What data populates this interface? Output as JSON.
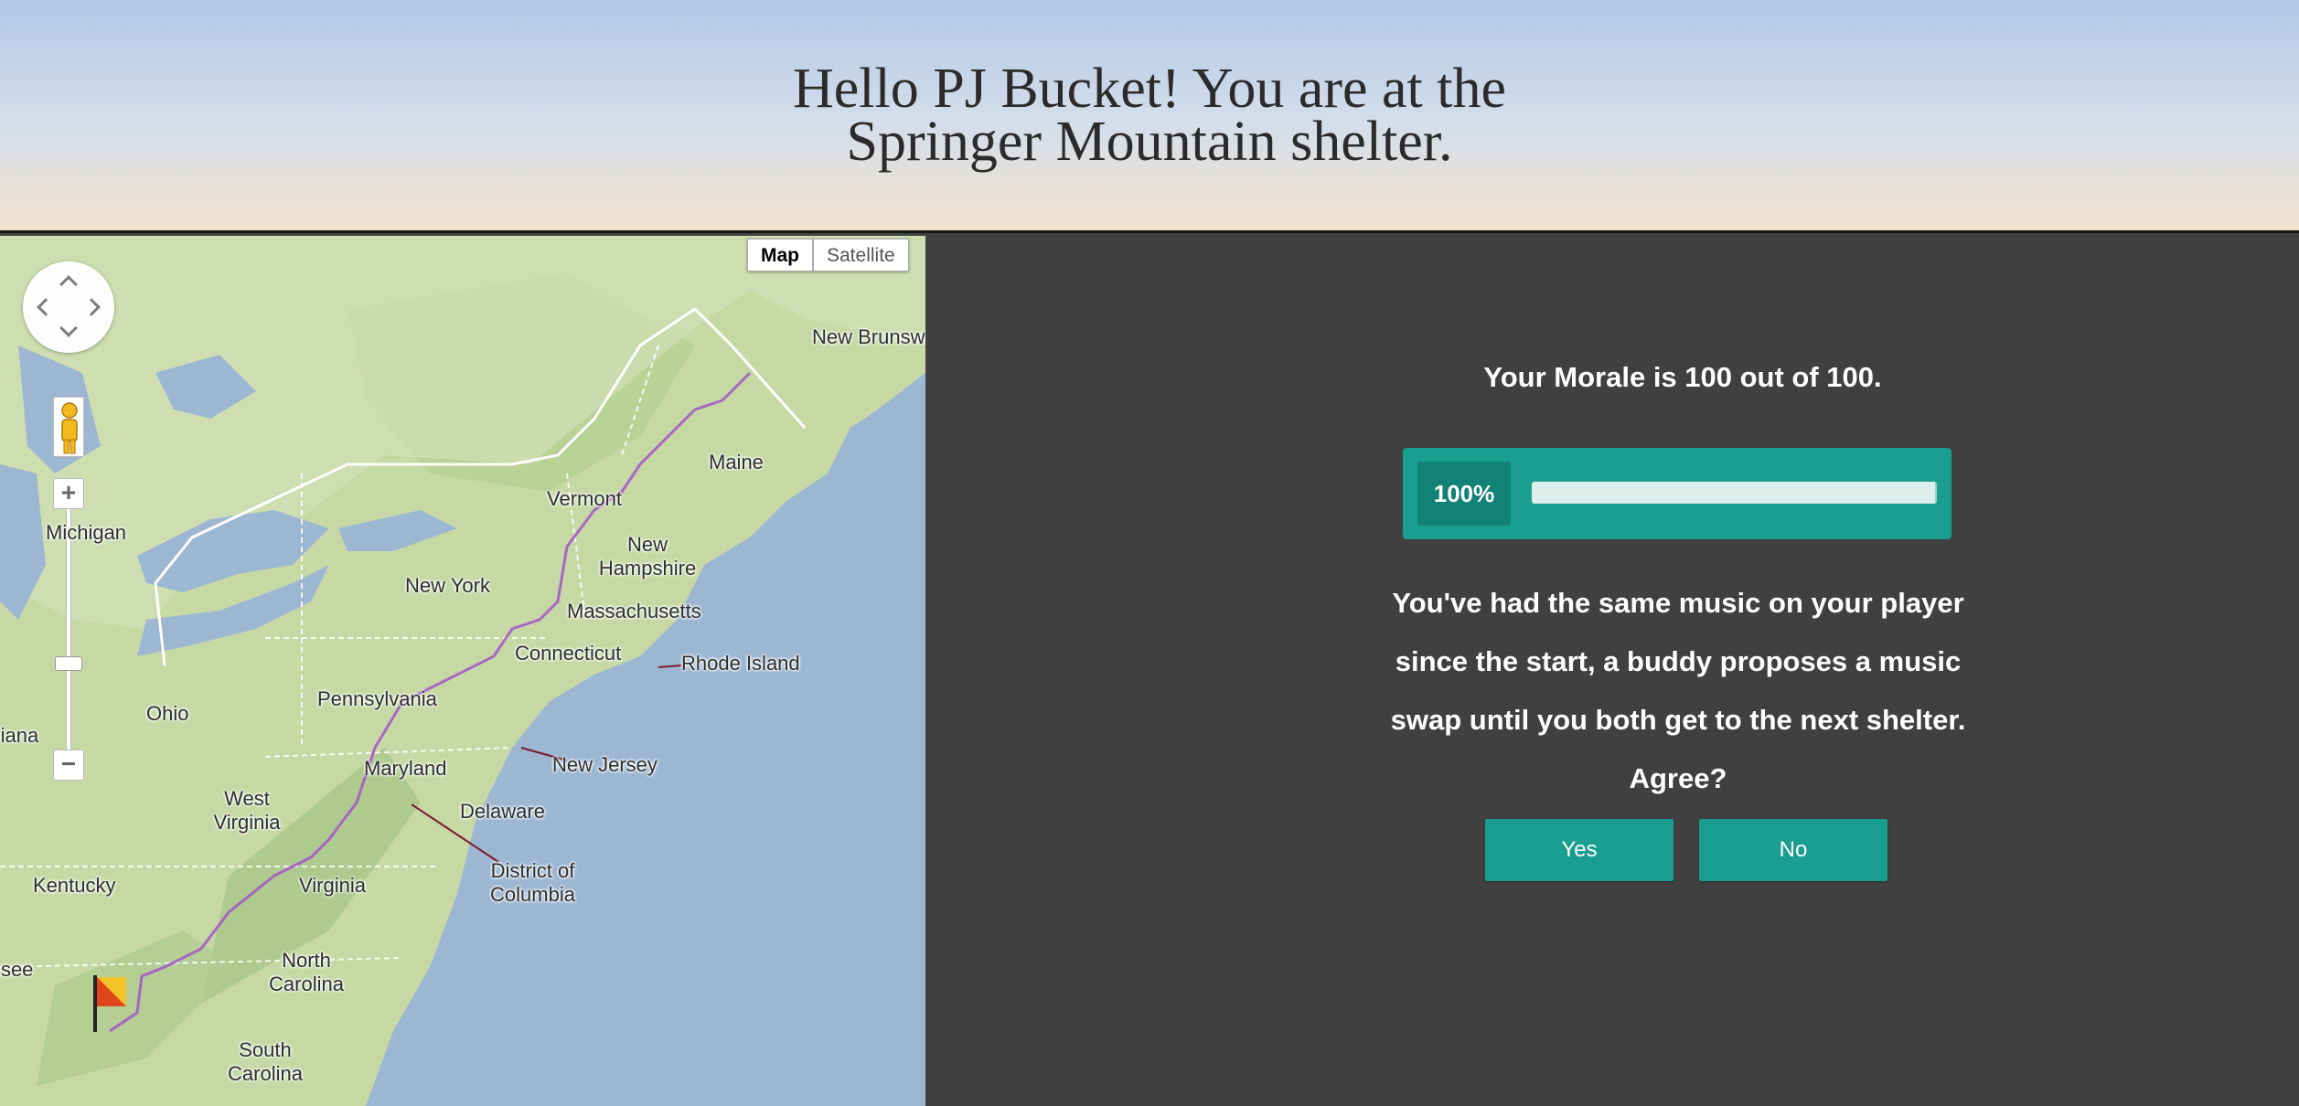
{
  "header": {
    "title": "Hello PJ Bucket! You are at the Springer Mountain shelter."
  },
  "map": {
    "type_buttons": [
      "Map",
      "Satellite"
    ],
    "active_type": "Map",
    "labels": [
      "New Brunswick",
      "Maine",
      "Vermont",
      "New Hampshire",
      "Michigan",
      "New York",
      "Massachusetts",
      "Connecticut",
      "Rhode Island",
      "Ohio",
      "Pennsylvania",
      "Indiana",
      "Maryland",
      "New Jersey",
      "West Virginia",
      "Delaware",
      "Kentucky",
      "District of Columbia",
      "Virginia",
      "Tennessee",
      "North Carolina",
      "South Carolina"
    ],
    "marker": "flag-icon"
  },
  "game": {
    "morale_text": "Your Morale is 100 out of 100.",
    "morale_value": 100,
    "morale_max": 100,
    "progress_label": "100%",
    "progress_fraction": 1.0,
    "story": "You've had the same music on your player since the start, a buddy proposes a music swap until you both get to the next shelter. Agree?",
    "yes_label": "Yes",
    "no_label": "No",
    "accent_color": "#1a9e8f"
  }
}
